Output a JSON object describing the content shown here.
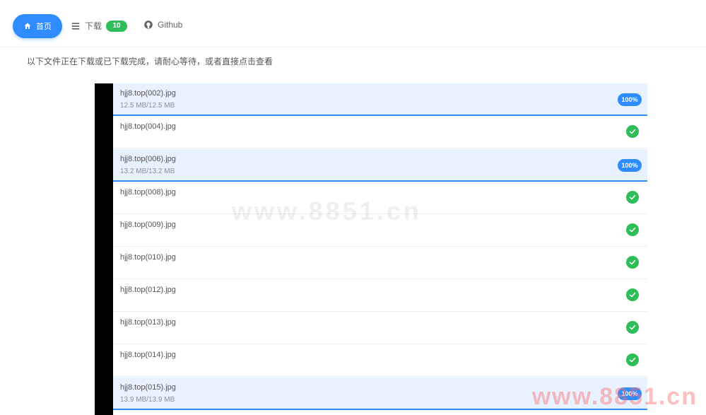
{
  "nav": {
    "home_label": "首页",
    "downloads_label": "下载",
    "downloads_count": "10",
    "github_label": "Github"
  },
  "notice": {
    "text": "以下文件正在下载或已下载完成，请耐心等待，或者直接点击查看"
  },
  "downloads": [
    {
      "name": "hjj8.top(002).jpg",
      "size": "12.5 MB/12.5 MB",
      "status": "progress",
      "percent": "100%"
    },
    {
      "name": "hjj8.top(004).jpg",
      "size": "",
      "status": "done"
    },
    {
      "name": "hjj8.top(006).jpg",
      "size": "13.2 MB/13.2 MB",
      "status": "progress",
      "percent": "100%"
    },
    {
      "name": "hjj8.top(008).jpg",
      "size": "",
      "status": "done"
    },
    {
      "name": "hjj8.top(009).jpg",
      "size": "",
      "status": "done"
    },
    {
      "name": "hjj8.top(010).jpg",
      "size": "",
      "status": "done"
    },
    {
      "name": "hjj8.top(012).jpg",
      "size": "",
      "status": "done"
    },
    {
      "name": "hjj8.top(013).jpg",
      "size": "",
      "status": "done"
    },
    {
      "name": "hjj8.top(014).jpg",
      "size": "",
      "status": "done"
    },
    {
      "name": "hjj8.top(015).jpg",
      "size": "13.9 MB/13.9 MB",
      "status": "progress",
      "percent": "100%"
    }
  ],
  "watermark": {
    "center": "www.8851.cn",
    "bottom": "www.8851.cn"
  },
  "colors": {
    "accent": "#2f8cff",
    "success": "#2ebd59",
    "active_row_bg": "#e8f2ff"
  }
}
